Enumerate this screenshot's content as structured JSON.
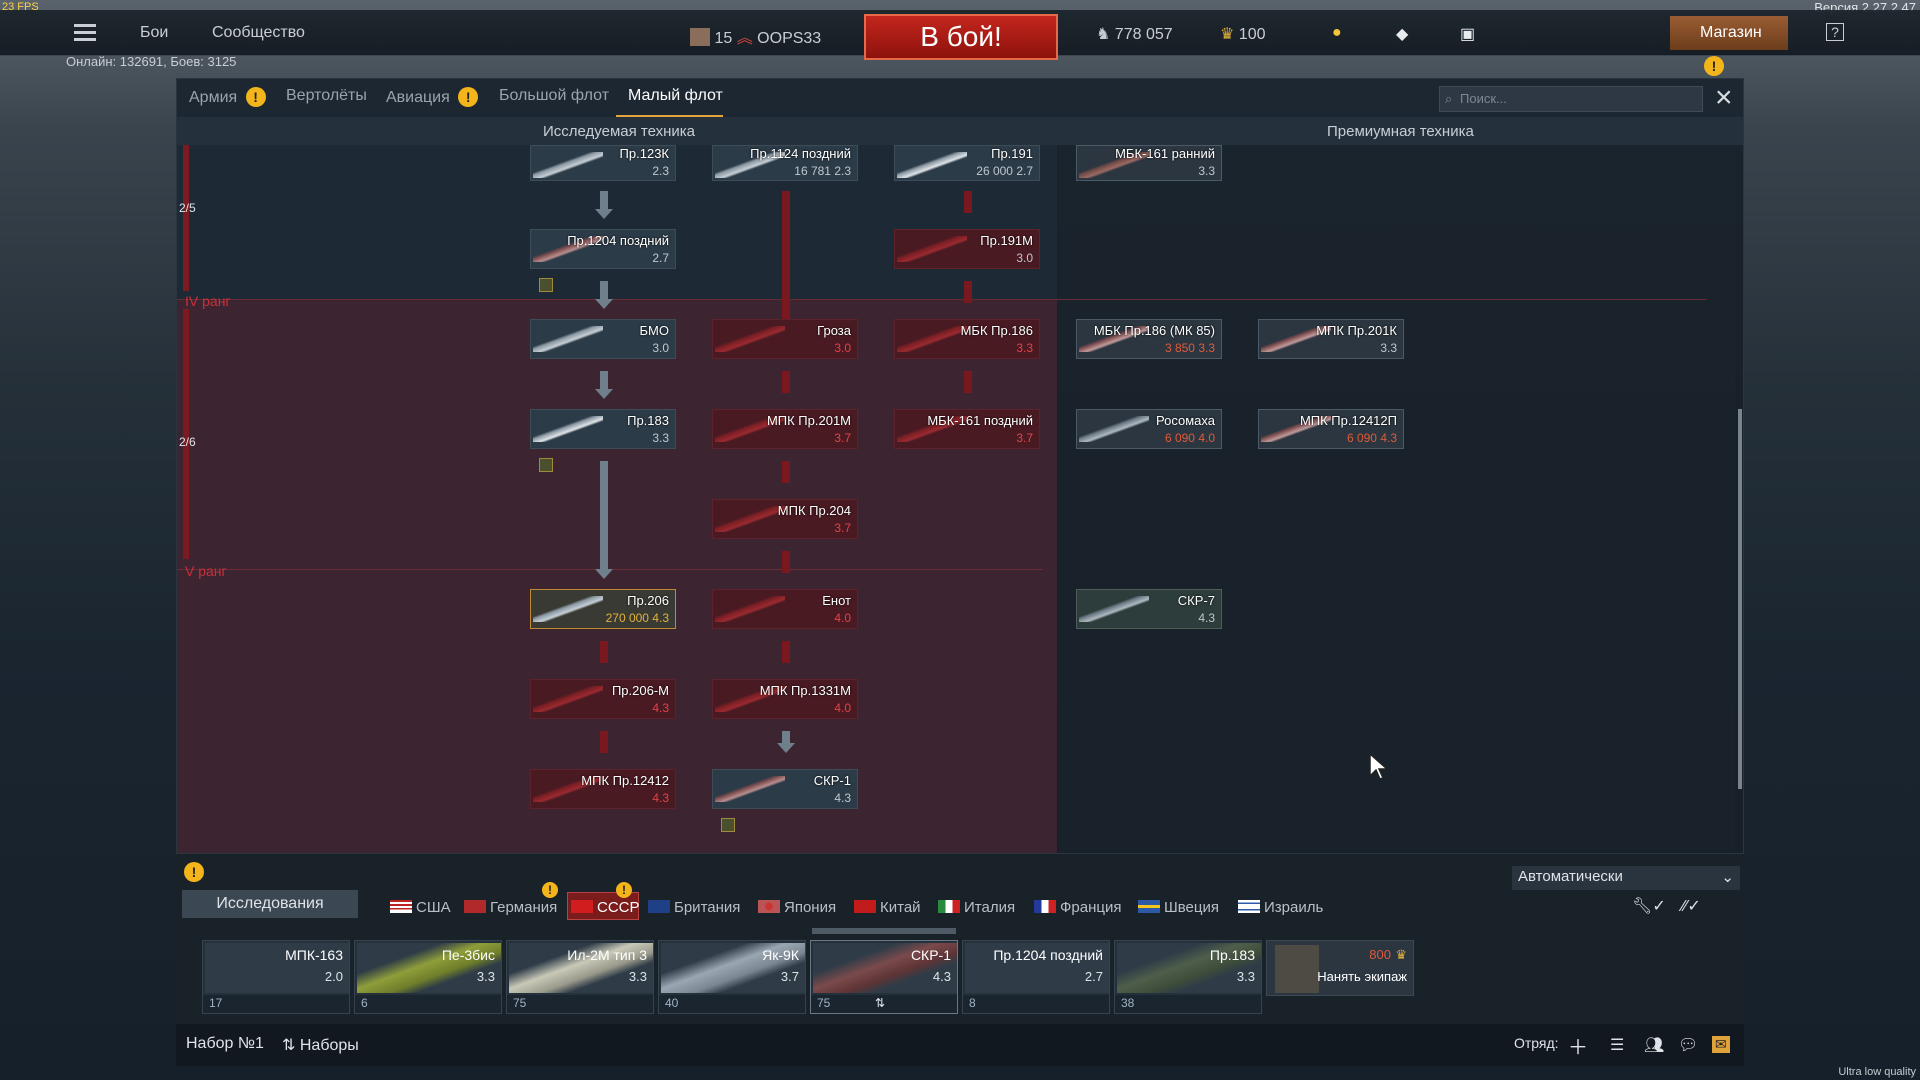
{
  "hud": {
    "fps": "23 FPS",
    "version": "Версия 2.27.2.47",
    "quality": "Ultra low quality"
  },
  "topbar": {
    "battles": "Бои",
    "community": "Сообщество",
    "rank_level": "15",
    "nickname": "OOPS33",
    "battle_button": "В бой!",
    "silver_lions": "778 057",
    "golden_eagles": "100",
    "shop": "Магазин",
    "online": "Онлайн: 132691, Боев: 3125"
  },
  "tabs": {
    "items": [
      "Армия",
      "Вертолёты",
      "Авиация",
      "Большой флот",
      "Малый флот"
    ],
    "active": "Малый флот",
    "search_placeholder": "Поиск..."
  },
  "subheader": {
    "researched": "Исследуемая техника",
    "premium": "Премиумная техника"
  },
  "ranks": {
    "rank4": "IV ранг",
    "rank5": "V ранг",
    "prog1": "2/5",
    "prog2": "2/6"
  },
  "cards": [
    {
      "name": "Пр.123К",
      "br": "2.3"
    },
    {
      "name": "Пр.1124 поздний",
      "br": "16 781 2.3"
    },
    {
      "name": "Пр.191",
      "br": "26 000 2.7"
    },
    {
      "name": "МБК-161 ранний",
      "br": "3.3"
    },
    {
      "name": "Пр.1204 поздний",
      "br": "2.7"
    },
    {
      "name": "Пр.191М",
      "br": "3.0"
    },
    {
      "name": "БМО",
      "br": "3.0"
    },
    {
      "name": "Гроза",
      "br": "3.0"
    },
    {
      "name": "МБК Пр.186",
      "br": "3.3"
    },
    {
      "name": "МБК Пр.186 (МК 85)",
      "br": "3 850 3.3"
    },
    {
      "name": "МПК Пр.201К",
      "br": "3.3"
    },
    {
      "name": "Пр.183",
      "br": "3.3"
    },
    {
      "name": "МПК Пр.201М",
      "br": "3.7"
    },
    {
      "name": "МБК-161 поздний",
      "br": "3.7"
    },
    {
      "name": "Росомаха",
      "br": "6 090 4.0"
    },
    {
      "name": "МПК Пр.12412П",
      "br": "6 090 4.3"
    },
    {
      "name": "МПК Пр.204",
      "br": "3.7"
    },
    {
      "name": "Пр.206",
      "br": "270 000 4.3"
    },
    {
      "name": "Енот",
      "br": "4.0"
    },
    {
      "name": "СКР-7",
      "br": "4.3"
    },
    {
      "name": "Пр.206-М",
      "br": "4.3"
    },
    {
      "name": "МПК Пр.1331М",
      "br": "4.0"
    },
    {
      "name": "МПК Пр.12412",
      "br": "4.3"
    },
    {
      "name": "СКР-1",
      "br": "4.3"
    }
  ],
  "bottom": {
    "mode_select": "Автоматически",
    "research_button": "Исследования",
    "nations": [
      "США",
      "Германия",
      "СССР",
      "Британия",
      "Япония",
      "Китай",
      "Италия",
      "Франция",
      "Швеция",
      "Израиль"
    ],
    "active_nation": "СССР",
    "slots": [
      {
        "name": "МПК-163",
        "br": "2.0",
        "count": "17"
      },
      {
        "name": "Пе-3бис",
        "br": "3.3",
        "count": "6"
      },
      {
        "name": "Ил-2М тип 3",
        "br": "3.3",
        "count": "75"
      },
      {
        "name": "Як-9К",
        "br": "3.7",
        "count": "40"
      },
      {
        "name": "СКР-1",
        "br": "4.3",
        "count": "75"
      },
      {
        "name": "Пр.1204 поздний",
        "br": "2.7",
        "count": "8"
      },
      {
        "name": "Пр.183",
        "br": "3.3",
        "count": "38"
      }
    ],
    "crew_cost": "800",
    "crew_label": "Нанять экипаж"
  },
  "footer": {
    "preset": "Набор №1",
    "presets": "Наборы",
    "squad": "Отряд:"
  },
  "colors": {
    "accent": "#e2a33a",
    "battle": "#b51c16",
    "locked": "#4a1a22"
  }
}
